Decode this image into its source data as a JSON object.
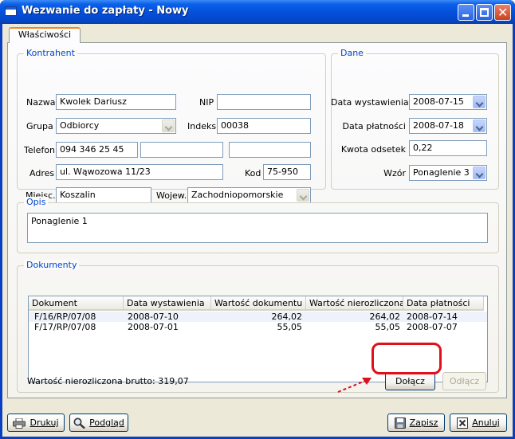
{
  "window": {
    "title": "Wezwanie do zapłaty - Nowy"
  },
  "tabs": [
    {
      "label": "Właściwości"
    }
  ],
  "kontrahent": {
    "title": "Kontrahent",
    "nazwa_label": "Nazwa",
    "nazwa_value": "Kwolek Dariusz",
    "nip_label": "NIP",
    "nip_value": "",
    "grupa_label": "Grupa",
    "grupa_value": "Odbiorcy",
    "indeks_label": "Indeks",
    "indeks_value": "00038",
    "telefon_label": "Telefon",
    "telefon_value": "094 346 25 45",
    "telefon2_value": "",
    "telefon3_value": "",
    "adres_label": "Adres",
    "adres_value": "ul. Wąwozowa 11/23",
    "kod_label": "Kod",
    "kod_value": "75-950",
    "miejsc_label": "Miejsc.",
    "miejsc_value": "Koszalin",
    "wojew_label": "Wojew.",
    "wojew_value": "Zachodniopomorskie"
  },
  "dane": {
    "title": "Dane",
    "data_wystawienia_label": "Data wystawienia",
    "data_wystawienia_value": "2008-07-15",
    "data_platnosci_label": "Data płatności",
    "data_platnosci_value": "2008-07-18",
    "kwota_odsetek_label": "Kwota odsetek",
    "kwota_odsetek_value": "0,22",
    "wzor_label": "Wzór",
    "wzor_value": "Ponaglenie 3"
  },
  "opis": {
    "title": "Opis",
    "value": "Ponaglenie 1"
  },
  "dokumenty": {
    "title": "Dokumenty",
    "columns": [
      "Dokument",
      "Data wystawienia",
      "Wartość dokumentu",
      "Wartość nierozliczona",
      "Data płatności"
    ],
    "rows": [
      [
        "F/16/RP/07/08",
        "2008-07-10",
        "264,02",
        "264,02",
        "2008-07-14"
      ],
      [
        "F/17/RP/07/08",
        "2008-07-01",
        "55,05",
        "55,05",
        "2008-07-07"
      ]
    ],
    "summary_text": "Wartość nierozliczona brutto: 319,07",
    "dolacz_label": "Dołącz",
    "odlacz_label": "Odłącz"
  },
  "footer": {
    "drukuj_label": "Drukuj",
    "podglad_label": "Podgląd",
    "zapisz_label": "Zapisz",
    "anuluj_label": "Anuluj"
  },
  "colors": {
    "accent": "#0046d5",
    "highlight": "#e0101a"
  }
}
